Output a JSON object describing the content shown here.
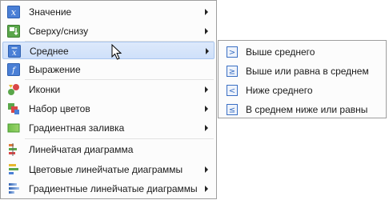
{
  "menu": {
    "items": [
      {
        "label": "Значение",
        "icon": "x-variable-icon",
        "submenu": true
      },
      {
        "label": "Сверху/снизу",
        "icon": "top-bottom-icon",
        "submenu": true
      },
      {
        "label": "Среднее",
        "icon": "x-bar-icon",
        "submenu": true,
        "highlighted": true
      },
      {
        "label": "Выражение",
        "icon": "function-icon",
        "submenu": false
      },
      {
        "label": "Иконки",
        "icon": "icon-set-icon",
        "submenu": true
      },
      {
        "label": "Набор цветов",
        "icon": "color-set-icon",
        "submenu": true
      },
      {
        "label": "Градиентная заливка",
        "icon": "gradient-fill-icon",
        "submenu": true
      },
      {
        "label": "Линейчатая диаграмма",
        "icon": "bar-chart-icon",
        "submenu": false
      },
      {
        "label": "Цветовые линейчатые диаграммы",
        "icon": "color-bar-chart-icon",
        "submenu": true
      },
      {
        "label": "Градиентные линейчатые диаграммы",
        "icon": "gradient-bar-chart-icon",
        "submenu": true
      }
    ]
  },
  "submenu": {
    "items": [
      {
        "label": "Выше среднего",
        "symbol": ">"
      },
      {
        "label": "Выше или равна в среднем",
        "symbol": "≥"
      },
      {
        "label": "Ниже среднего",
        "symbol": "<"
      },
      {
        "label": "В среднем ниже или равны",
        "symbol": "≤"
      }
    ]
  },
  "colors": {
    "highlight": "#cfe0fa",
    "highlight_border": "#a9c6ef",
    "icon_blue": "#3a6fc4"
  }
}
